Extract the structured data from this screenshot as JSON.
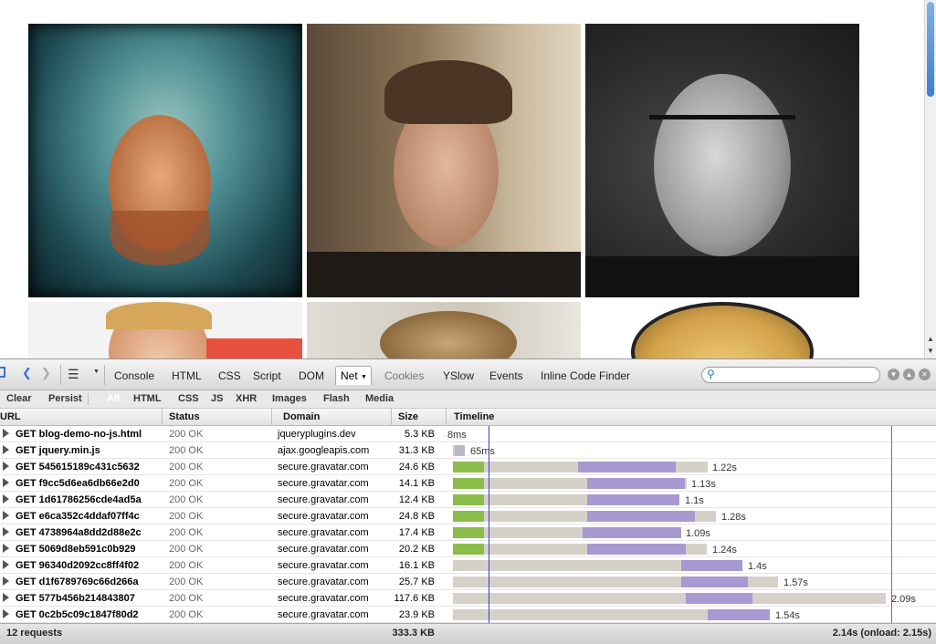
{
  "colors": {
    "connecting": "#8bbd4a",
    "waiting": "#d5d1c8",
    "receiving": "#a89ad0",
    "dom_line": "#3a45c9",
    "load_line": "#dd4444"
  },
  "toolbar": {
    "tabs": [
      "Console",
      "HTML",
      "CSS",
      "Script",
      "DOM",
      "Net",
      "Cookies",
      "YSlow",
      "Events",
      "Inline Code Finder"
    ],
    "active_tab": "Net",
    "search_placeholder": ""
  },
  "filters": {
    "clear": "Clear",
    "persist": "Persist",
    "items": [
      "All",
      "HTML",
      "CSS",
      "JS",
      "XHR",
      "Images",
      "Flash",
      "Media"
    ],
    "selected": "All"
  },
  "columns": {
    "url": "URL",
    "status": "Status",
    "domain": "Domain",
    "size": "Size",
    "timeline": "Timeline"
  },
  "requests": [
    {
      "url": "GET blog-demo-no-js.html",
      "status": "200 OK",
      "domain": "jqueryplugins.dev",
      "size": "5.3 KB",
      "time": "8ms"
    },
    {
      "url": "GET jquery.min.js",
      "status": "200 OK",
      "domain": "ajax.googleapis.com",
      "size": "31.3 KB",
      "time": "65ms"
    },
    {
      "url": "GET 545615189c431c5632",
      "status": "200 OK",
      "domain": "secure.gravatar.com",
      "size": "24.6 KB",
      "time": "1.22s"
    },
    {
      "url": "GET f9cc5d6ea6db66e2d0",
      "status": "200 OK",
      "domain": "secure.gravatar.com",
      "size": "14.1 KB",
      "time": "1.13s"
    },
    {
      "url": "GET 1d61786256cde4ad5a",
      "status": "200 OK",
      "domain": "secure.gravatar.com",
      "size": "12.4 KB",
      "time": "1.1s"
    },
    {
      "url": "GET e6ca352c4ddaf07ff4c",
      "status": "200 OK",
      "domain": "secure.gravatar.com",
      "size": "24.8 KB",
      "time": "1.28s"
    },
    {
      "url": "GET 4738964a8dd2d88e2c",
      "status": "200 OK",
      "domain": "secure.gravatar.com",
      "size": "17.4 KB",
      "time": "1.09s"
    },
    {
      "url": "GET 5069d8eb591c0b929",
      "status": "200 OK",
      "domain": "secure.gravatar.com",
      "size": "20.2 KB",
      "time": "1.24s"
    },
    {
      "url": "GET 96340d2092cc8ff4f02",
      "status": "200 OK",
      "domain": "secure.gravatar.com",
      "size": "16.1 KB",
      "time": "1.4s"
    },
    {
      "url": "GET d1f6789769c66d266a",
      "status": "200 OK",
      "domain": "secure.gravatar.com",
      "size": "25.7 KB",
      "time": "1.57s"
    },
    {
      "url": "GET 577b456b214843807",
      "status": "200 OK",
      "domain": "secure.gravatar.com",
      "size": "117.6 KB",
      "time": "2.09s"
    },
    {
      "url": "GET 0c2b5c09c1847f80d2",
      "status": "200 OK",
      "domain": "secure.gravatar.com",
      "size": "23.9 KB",
      "time": "1.54s"
    }
  ],
  "summary": {
    "count": "12 requests",
    "total_size": "333.3 KB",
    "total_time": "2.14s (onload: 2.15s)"
  },
  "page_images": [
    {
      "name": "avatar-hooded-man"
    },
    {
      "name": "avatar-man-hand-on-head"
    },
    {
      "name": "avatar-man-glasses-bw"
    },
    {
      "name": "avatar-blond-man"
    },
    {
      "name": "avatar-curly-hair"
    },
    {
      "name": "avatar-cartoon-hair"
    }
  ]
}
